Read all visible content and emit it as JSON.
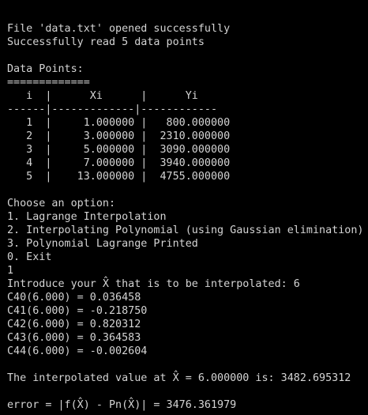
{
  "terminal": {
    "lines_top": [
      "File 'data.txt' opened successfully",
      "Successfully read 5 data points"
    ],
    "data_points_heading": "Data Points:",
    "heading_underline": "=============",
    "table": {
      "header": "   i  |      Xi      |      Yi",
      "separator": "------|-------------|------------",
      "rows": [
        "   1  |     1.000000 |   800.000000",
        "   2  |     3.000000 |  2310.000000",
        "   3  |     5.000000 |  3090.000000",
        "   4  |     7.000000 |  3940.000000",
        "   5  |    13.000000 |  4755.000000"
      ]
    },
    "menu": {
      "prompt": "Choose an option:",
      "options": [
        "1. Lagrange Interpolation",
        "2. Interpolating Polynomial (using Gaussian elimination)",
        "3. Polynomial Lagrange Printed",
        "0. Exit"
      ]
    },
    "user_choice": "1",
    "interp_prompt": "Introduce your X̂ that is to be interpolated: 6",
    "coefficients": [
      "C40(6.000) = 0.036458",
      "C41(6.000) = -0.218750",
      "C42(6.000) = 0.820312",
      "C43(6.000) = 0.364583",
      "C44(6.000) = -0.002604"
    ],
    "result": "The interpolated value at X̂ = 6.000000 is: 3482.695312",
    "error": "error = |f(X̂) - Pn(X̂)| = 3476.361979"
  }
}
